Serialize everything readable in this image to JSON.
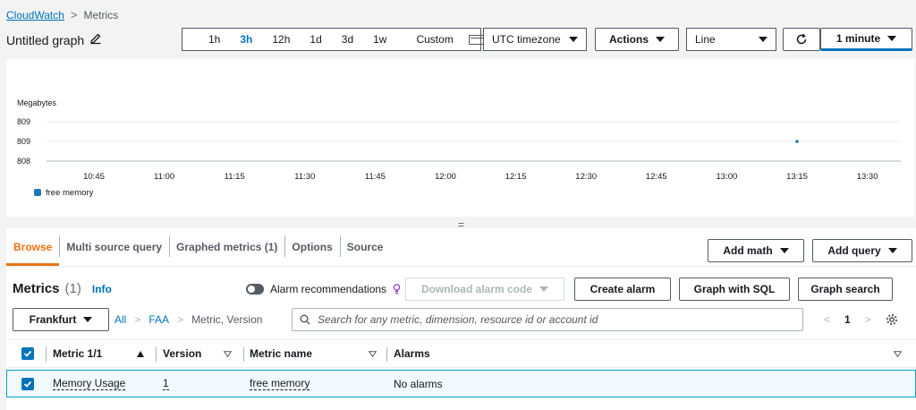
{
  "breadcrumb": {
    "root": "CloudWatch",
    "current": "Metrics"
  },
  "graph": {
    "title": "Untitled graph"
  },
  "time_range": {
    "options": [
      "1h",
      "3h",
      "12h",
      "1d",
      "3d",
      "1w"
    ],
    "active": "3h",
    "custom_label": "Custom"
  },
  "timezone": {
    "value": "UTC timezone"
  },
  "actions": {
    "label": "Actions"
  },
  "chart_type_select": {
    "value": "Line"
  },
  "refresh": {
    "interval": "1 minute"
  },
  "chart_data": {
    "type": "line",
    "ylabel": "Megabytes",
    "y_ticks": [
      "809",
      "809",
      "808"
    ],
    "x_ticks": [
      "10:45",
      "11:00",
      "11:15",
      "11:30",
      "11:45",
      "12:00",
      "12:15",
      "12:30",
      "12:45",
      "13:00",
      "13:15",
      "13:30"
    ],
    "series": [
      {
        "name": "free memory",
        "color": "#1f77b4",
        "points": [
          {
            "x": "13:15",
            "y": 809
          }
        ]
      }
    ],
    "grid": true,
    "legend": "bottom-left"
  },
  "divider": "=",
  "tabs": [
    "Browse",
    "Multi source query",
    "Graphed metrics (1)",
    "Options",
    "Source"
  ],
  "active_tab": "Browse",
  "add_math": "Add math",
  "add_query": "Add query",
  "metrics_header": {
    "title": "Metrics",
    "count": "(1)",
    "info": "Info"
  },
  "alarm_recommendations": "Alarm recommendations",
  "download_alarm_code": "Download alarm code",
  "buttons": {
    "create_alarm": "Create alarm",
    "graph_sql": "Graph with SQL",
    "graph_search": "Graph search"
  },
  "region": "Frankfurt",
  "nav": {
    "all": "All",
    "faa": "FAA",
    "dims": "Metric, Version"
  },
  "search": {
    "placeholder": "Search for any metric, dimension, resource id or account id"
  },
  "pagination": {
    "page": "1"
  },
  "table": {
    "headers": [
      "Metric 1/1",
      "Version",
      "Metric name",
      "Alarms"
    ],
    "rows": [
      {
        "metric": "Memory Usage",
        "version": "1",
        "metric_name": "free memory",
        "alarms": "No alarms"
      }
    ]
  },
  "accent": "#0073bb",
  "tab_accent": "#ec7211"
}
